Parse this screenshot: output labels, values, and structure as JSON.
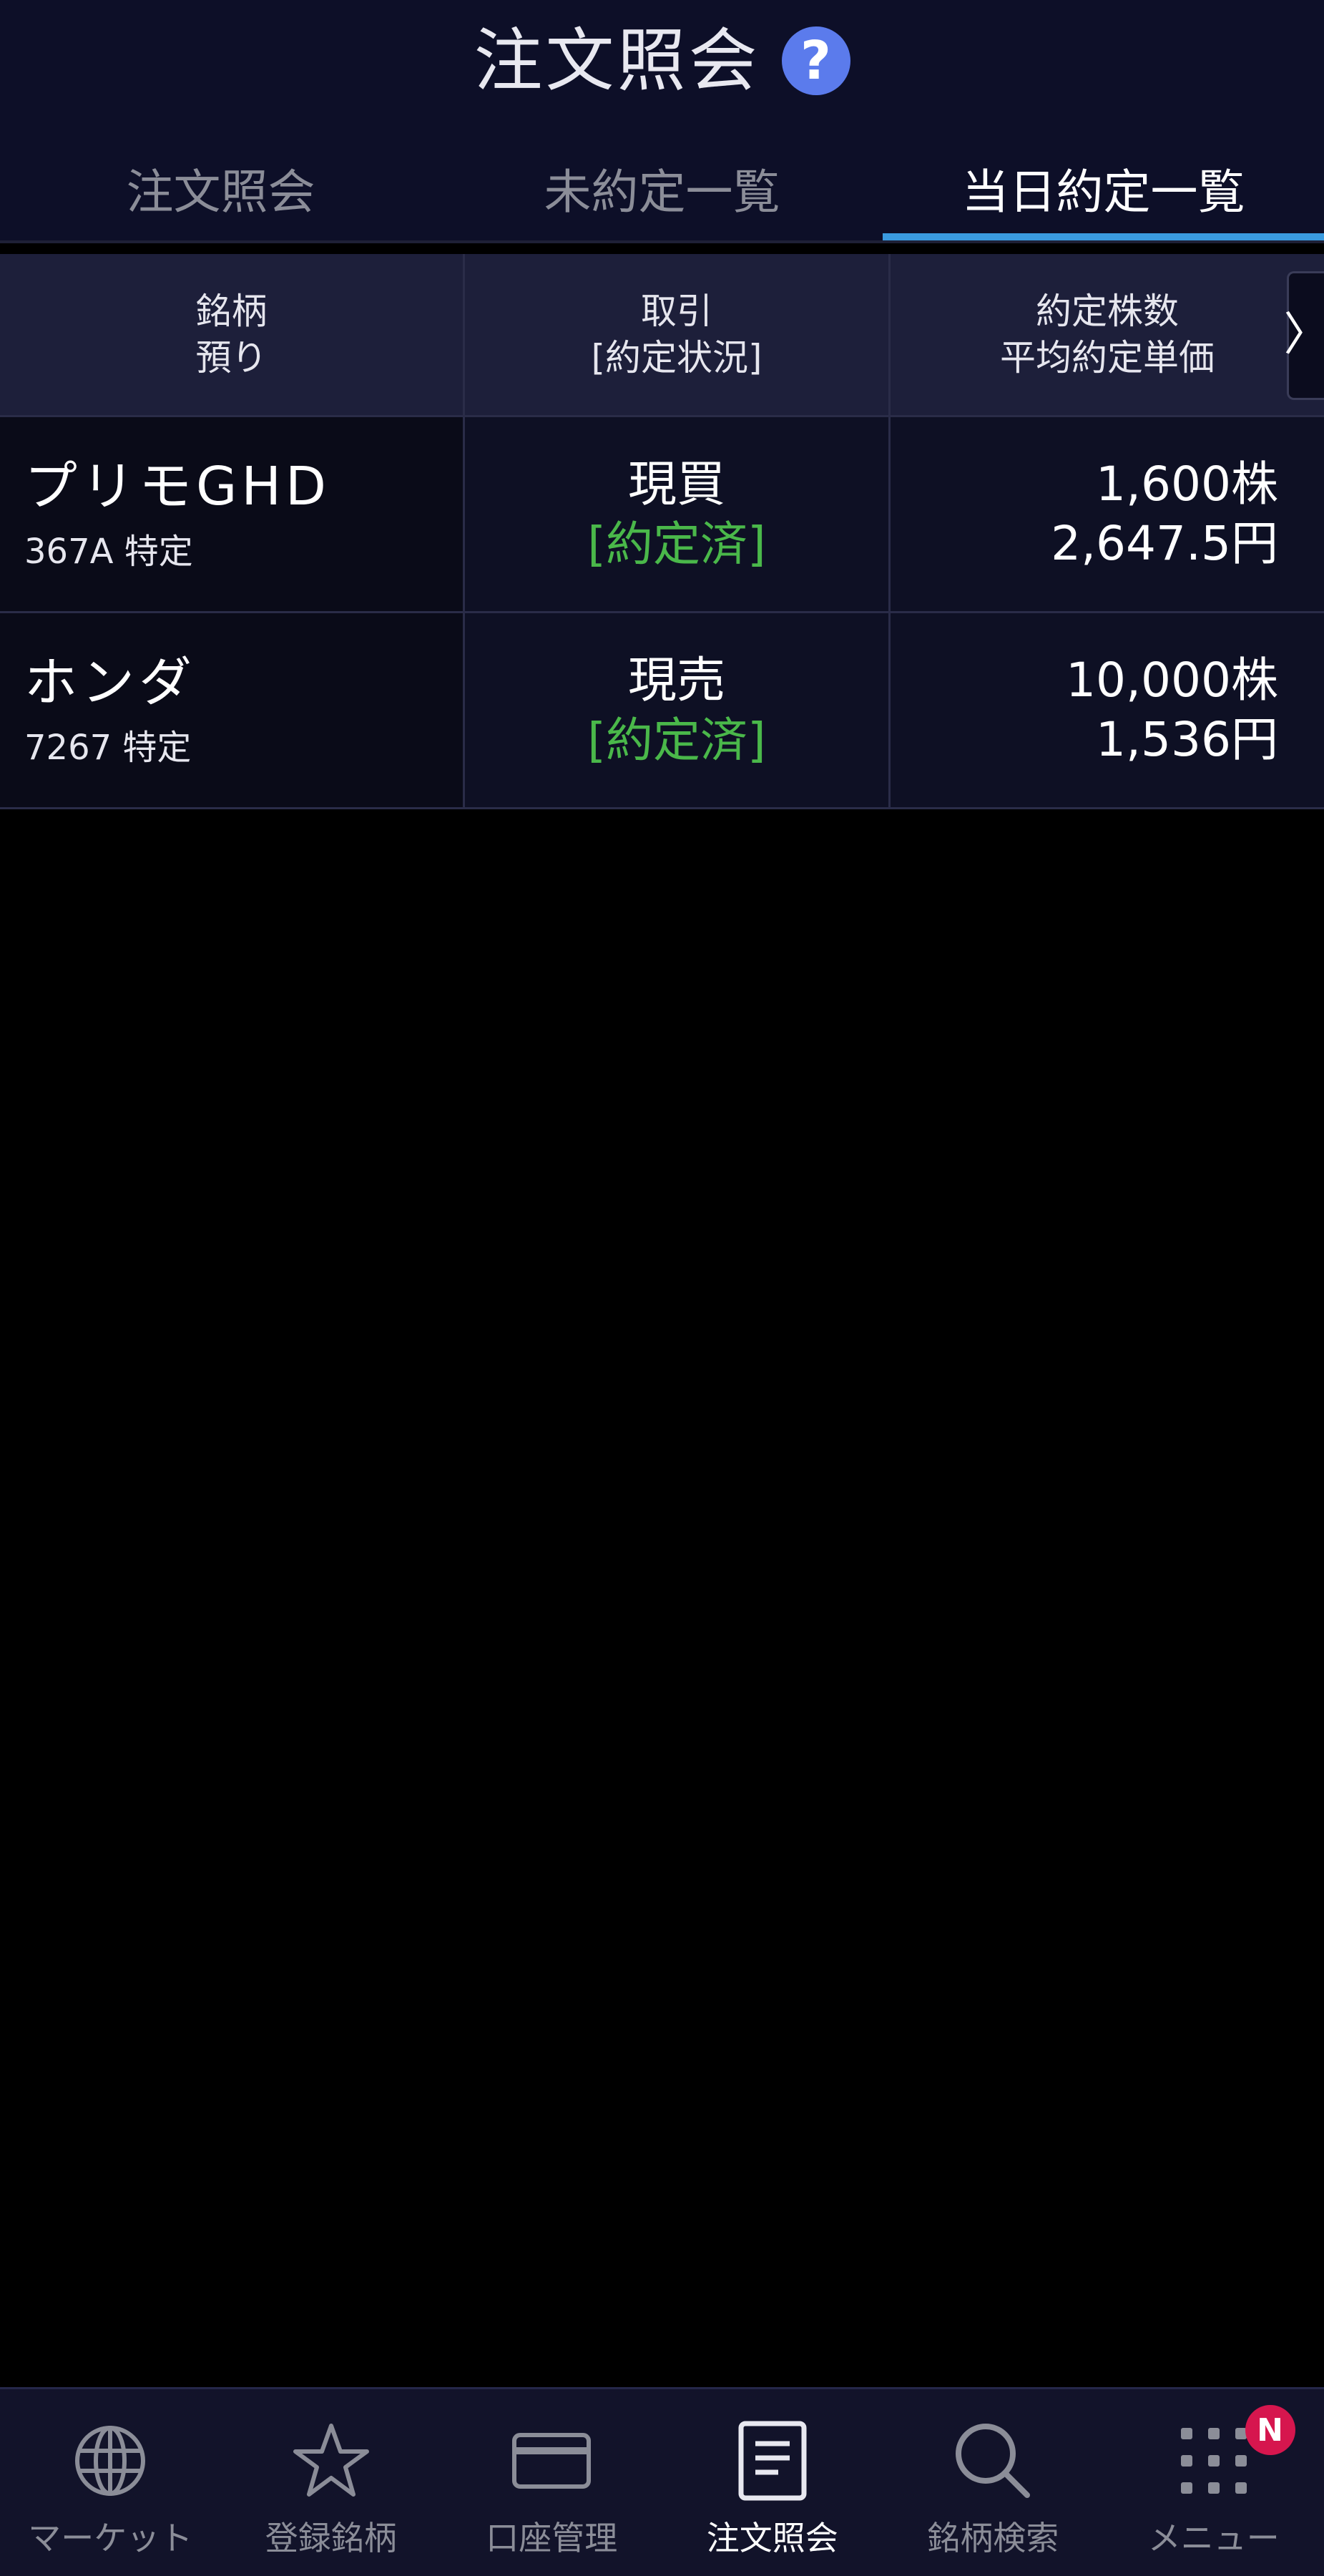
{
  "header": {
    "title": "注文照会",
    "help_label": "?"
  },
  "tabs": [
    {
      "label": "注文照会",
      "active": false
    },
    {
      "label": "未約定一覧",
      "active": false
    },
    {
      "label": "当日約定一覧",
      "active": true
    }
  ],
  "table": {
    "headers": {
      "col1_line1": "銘柄",
      "col1_line2": "預り",
      "col2_line1": "取引",
      "col2_line2": "[約定状況]",
      "col3_line1": "約定株数",
      "col3_line2": "平均約定単価"
    },
    "scroll_icon": "〉",
    "rows": [
      {
        "name": "プリモGHD",
        "sub": "367A 特定",
        "trade": "現買",
        "status": "[約定済]",
        "qty": "1,600株",
        "price": "2,647.5円"
      },
      {
        "name": "ホンダ",
        "sub": "7267 特定",
        "trade": "現売",
        "status": "[約定済]",
        "qty": "10,000株",
        "price": "1,536円"
      }
    ]
  },
  "nav": [
    {
      "label": "マーケット",
      "icon": "globe-icon"
    },
    {
      "label": "登録銘柄",
      "icon": "star-icon"
    },
    {
      "label": "口座管理",
      "icon": "card-icon"
    },
    {
      "label": "注文照会",
      "icon": "document-icon",
      "active": true
    },
    {
      "label": "銘柄検索",
      "icon": "search-icon"
    },
    {
      "label": "メニュー",
      "icon": "grid-icon",
      "badge": "N"
    }
  ],
  "colors": {
    "header_bg": "#0d0f28",
    "active_tab_underline": "#3a9be0",
    "status_green": "#4ab84a",
    "badge_red": "#d6164e",
    "help_blue": "#5b7bec"
  }
}
